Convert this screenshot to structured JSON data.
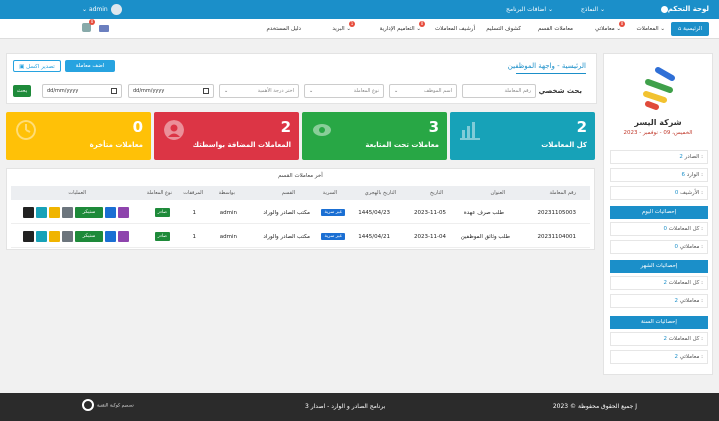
{
  "topbar": {
    "brand": "لوحة التحكم",
    "menu": [
      "النماذج",
      "اضافات البرنامج"
    ],
    "user": "admin"
  },
  "nav": {
    "home": "الرئيسية",
    "items": [
      {
        "label": "المعاملات",
        "badge": ""
      },
      {
        "label": "معاملاتي",
        "badge": "0"
      },
      {
        "label": "معاملات القسم",
        "badge": ""
      },
      {
        "label": "كشوف التسليم",
        "badge": ""
      },
      {
        "label": "أرشيف المعاملات",
        "badge": ""
      },
      {
        "label": "التعاميم الإدارية",
        "badge": "0"
      },
      {
        "label": "البريد",
        "badge": "1"
      },
      {
        "label": "دليل المستخدم",
        "badge": ""
      }
    ],
    "bell_badge": "0"
  },
  "sidebar": {
    "company": "شركة اليسر",
    "date": "الخميس، 09 - نوفمبر - 2023",
    "rows": [
      {
        "label": "الصادر :",
        "value": "2"
      },
      {
        "label": "الوارد :",
        "value": "6"
      },
      {
        "label": "الأرشيف :",
        "value": "0"
      }
    ],
    "today_title": "إحصائيات اليوم",
    "today": [
      {
        "label": "كل المعاملات :",
        "value": "0"
      },
      {
        "label": "معاملاتي :",
        "value": "0"
      }
    ],
    "month_title": "إحصائيات الشهر",
    "month": [
      {
        "label": "كل المعاملات :",
        "value": "2"
      },
      {
        "label": "معاملاتي :",
        "value": "2"
      }
    ],
    "year_title": "إحصائيات السنة",
    "year": [
      {
        "label": "كل المعاملات :",
        "value": "2"
      },
      {
        "label": "معاملاتي :",
        "value": "2"
      }
    ]
  },
  "main": {
    "breadcrumb": "الرئيسية - واجهة الموظفين",
    "add_button": "اضف معاملة",
    "export_button": "تصدير اكسل",
    "search_label": "بحث شخصي",
    "search_placeholder": "رقم المعاملة",
    "filters": [
      "اسم الموظف",
      "نوع المعاملة",
      "اختر درجة الأهمية"
    ],
    "date_placeholder": "dd/mm/yyyy",
    "search_button": "بحث"
  },
  "cards": [
    {
      "number": "2",
      "label": "كل المعاملات",
      "color": "#17a2b8"
    },
    {
      "number": "3",
      "label": "معاملات تحت المتابعة",
      "color": "#28a745"
    },
    {
      "number": "2",
      "label": "المعاملات المضافة بواسطتك",
      "color": "#dc3545"
    },
    {
      "number": "0",
      "label": "معاملات متأخرة",
      "color": "#ffc107"
    }
  ],
  "table": {
    "title": "آخر معاملات القسم",
    "headers": [
      "رقم المعاملة",
      "العنوان",
      "التاريخ",
      "التاريخ بالهجري",
      "السرية",
      "القسم",
      "بواسطة",
      "المرفقات",
      "نوع المعاملة",
      "العمليات"
    ],
    "rows": [
      {
        "id": "20231105003",
        "title": "طلب صرف عهدة",
        "date": "2023-11-05",
        "hijri": "1445/04/23",
        "secrecy": "غير سرية",
        "dept": "مكتب الصادر والوراد",
        "by": "admin",
        "attachments": "1",
        "type": "صادر"
      },
      {
        "id": "20231104001",
        "title": "طلب وثائق الموظفين",
        "date": "2023-11-04",
        "hijri": "1445/04/21",
        "secrecy": "غير سرية",
        "dept": "مكتب الصادر والوراد",
        "by": "admin",
        "attachments": "1",
        "type": "صادر"
      }
    ],
    "sticker_label": "ستيكر"
  },
  "footer": {
    "copyright": "جميع الحقوق محفوظة © 2023 J",
    "program": "برنامج الصادر و الوارد - اصدار 3",
    "designer": "تصميم كوكبة التقنية"
  }
}
